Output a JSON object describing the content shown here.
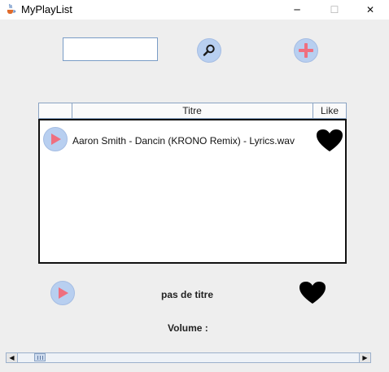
{
  "window": {
    "title": "MyPlayList",
    "app_icon": "java-cup-icon",
    "controls": {
      "minimize": "─",
      "maximize": "☐",
      "close": "✕"
    }
  },
  "toolbar": {
    "search_value": "",
    "search_icon": "magnifier-icon",
    "add_icon": "plus-icon"
  },
  "table": {
    "columns": [
      "",
      "Titre",
      "Like"
    ],
    "rows": [
      {
        "title": "Aaron Smith - Dancin (KRONO Remix) - Lyrics.wav",
        "liked": true
      }
    ]
  },
  "player": {
    "now_playing": "pas de titre",
    "volume_label": "Volume :",
    "volume_level": 0.05
  },
  "colors": {
    "button_bg": "#b8cff0",
    "play_arrow": "#ef6f7f",
    "plus": "#ef6f7f",
    "heart": "#000000"
  }
}
